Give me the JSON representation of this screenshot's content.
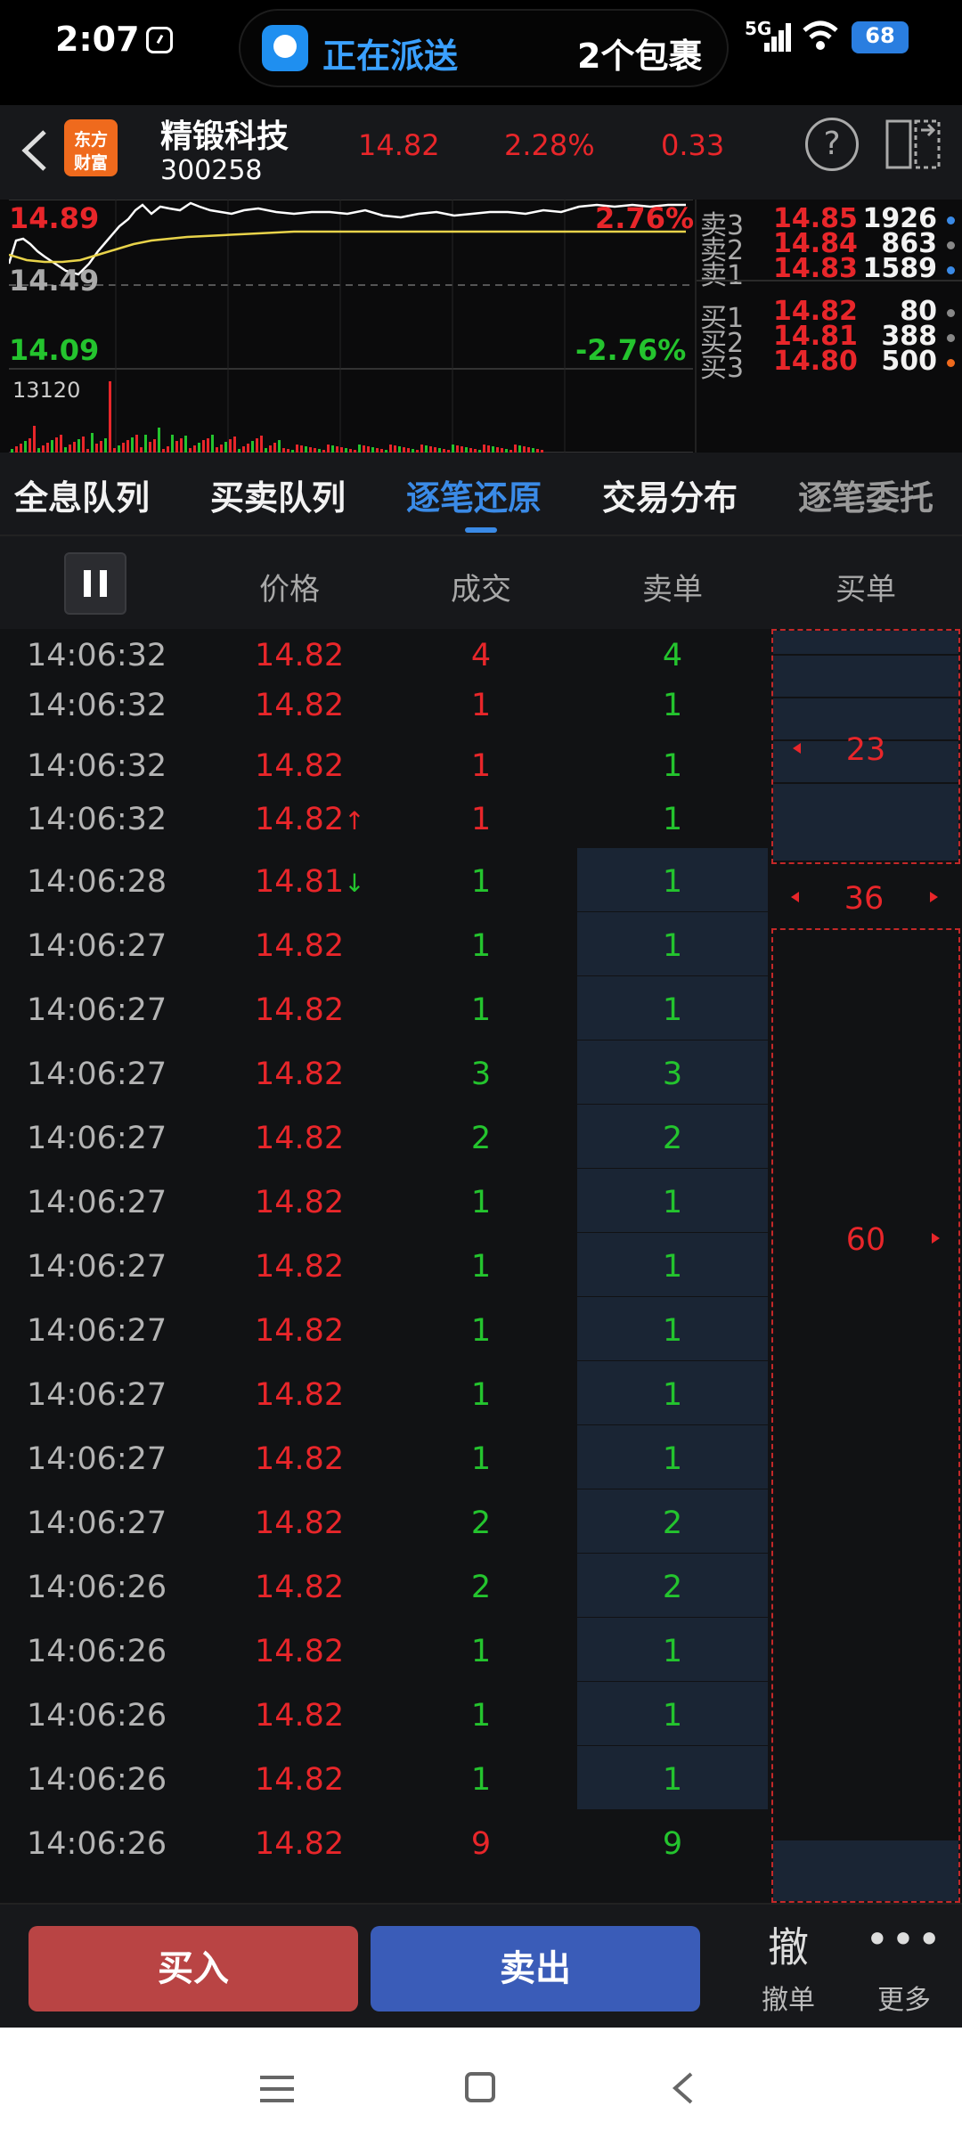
{
  "status": {
    "time": "2:07",
    "pill_label": "正在派送",
    "pill_count": "2个包裹",
    "network": "5G",
    "battery": "68"
  },
  "header": {
    "logo_line1": "东方",
    "logo_line2": "财富",
    "name": "精锻科技",
    "code": "300258",
    "price": "14.82",
    "pct": "2.28%",
    "change": "0.33"
  },
  "chart": {
    "top_price": "14.89",
    "top_pct": "2.76%",
    "mid_price": "14.49",
    "bottom_price": "14.09",
    "bottom_pct": "-2.76%",
    "volume_max": "13120",
    "colors": {
      "price_line": "#ffffff",
      "avg_line": "#e8d34a",
      "up": "#e8262a",
      "down": "#24c42e"
    }
  },
  "order_book": {
    "asks": [
      {
        "label": "卖3",
        "price": "14.85",
        "vol": "1926",
        "dot": "#3a8ae6"
      },
      {
        "label": "卖2",
        "price": "14.84",
        "vol": "863",
        "dot": "#888888"
      },
      {
        "label": "卖1",
        "price": "14.83",
        "vol": "1589",
        "dot": "#3a8ae6"
      }
    ],
    "bids": [
      {
        "label": "买1",
        "price": "14.82",
        "vol": "80",
        "dot": "#888888"
      },
      {
        "label": "买2",
        "price": "14.81",
        "vol": "388",
        "dot": "#888888"
      },
      {
        "label": "买3",
        "price": "14.80",
        "vol": "500",
        "dot": "#ef6a1d"
      }
    ]
  },
  "tabs": [
    "全息队列",
    "买卖队列",
    "逐笔还原",
    "交易分布",
    "逐笔委托"
  ],
  "active_tab": 2,
  "columns": {
    "price": "价格",
    "volume": "成交",
    "sell": "卖单",
    "buy": "买单"
  },
  "trades": [
    {
      "time": "14:06:32",
      "price": "14.82",
      "arrow": "",
      "vol": "4",
      "vol_color": "red",
      "sell": "4",
      "sell_hl": false
    },
    {
      "time": "14:06:32",
      "price": "14.82",
      "arrow": "",
      "vol": "1",
      "vol_color": "red",
      "sell": "1",
      "sell_hl": false
    },
    {
      "time": "14:06:32",
      "price": "14.82",
      "arrow": "",
      "vol": "1",
      "vol_color": "red",
      "sell": "1",
      "sell_hl": false
    },
    {
      "time": "14:06:32",
      "price": "14.82",
      "arrow": "↑",
      "vol": "1",
      "vol_color": "red",
      "sell": "1",
      "sell_hl": false
    },
    {
      "time": "14:06:28",
      "price": "14.81",
      "arrow": "↓",
      "vol": "1",
      "vol_color": "green",
      "sell": "1",
      "sell_hl": true
    },
    {
      "time": "14:06:27",
      "price": "14.82",
      "arrow": "",
      "vol": "1",
      "vol_color": "green",
      "sell": "1",
      "sell_hl": true
    },
    {
      "time": "14:06:27",
      "price": "14.82",
      "arrow": "",
      "vol": "1",
      "vol_color": "green",
      "sell": "1",
      "sell_hl": true
    },
    {
      "time": "14:06:27",
      "price": "14.82",
      "arrow": "",
      "vol": "3",
      "vol_color": "green",
      "sell": "3",
      "sell_hl": true
    },
    {
      "time": "14:06:27",
      "price": "14.82",
      "arrow": "",
      "vol": "2",
      "vol_color": "green",
      "sell": "2",
      "sell_hl": true
    },
    {
      "time": "14:06:27",
      "price": "14.82",
      "arrow": "",
      "vol": "1",
      "vol_color": "green",
      "sell": "1",
      "sell_hl": true
    },
    {
      "time": "14:06:27",
      "price": "14.82",
      "arrow": "",
      "vol": "1",
      "vol_color": "green",
      "sell": "1",
      "sell_hl": true
    },
    {
      "time": "14:06:27",
      "price": "14.82",
      "arrow": "",
      "vol": "1",
      "vol_color": "green",
      "sell": "1",
      "sell_hl": true
    },
    {
      "time": "14:06:27",
      "price": "14.82",
      "arrow": "",
      "vol": "1",
      "vol_color": "green",
      "sell": "1",
      "sell_hl": true
    },
    {
      "time": "14:06:27",
      "price": "14.82",
      "arrow": "",
      "vol": "1",
      "vol_color": "green",
      "sell": "1",
      "sell_hl": true
    },
    {
      "time": "14:06:27",
      "price": "14.82",
      "arrow": "",
      "vol": "2",
      "vol_color": "green",
      "sell": "2",
      "sell_hl": true
    },
    {
      "time": "14:06:26",
      "price": "14.82",
      "arrow": "",
      "vol": "2",
      "vol_color": "green",
      "sell": "2",
      "sell_hl": true
    },
    {
      "time": "14:06:26",
      "price": "14.82",
      "arrow": "",
      "vol": "1",
      "vol_color": "green",
      "sell": "1",
      "sell_hl": true
    },
    {
      "time": "14:06:26",
      "price": "14.82",
      "arrow": "",
      "vol": "1",
      "vol_color": "green",
      "sell": "1",
      "sell_hl": true
    },
    {
      "time": "14:06:26",
      "price": "14.82",
      "arrow": "",
      "vol": "1",
      "vol_color": "green",
      "sell": "1",
      "sell_hl": true
    },
    {
      "time": "14:06:26",
      "price": "14.82",
      "arrow": "",
      "vol": "9",
      "vol_color": "red",
      "sell": "9",
      "sell_hl": false
    }
  ],
  "buy_orders": {
    "first": "23",
    "second": "36",
    "third": "60"
  },
  "actions": {
    "buy": "买入",
    "sell": "卖出",
    "cancel_glyph": "撤",
    "cancel": "撤单",
    "more": "更多"
  }
}
